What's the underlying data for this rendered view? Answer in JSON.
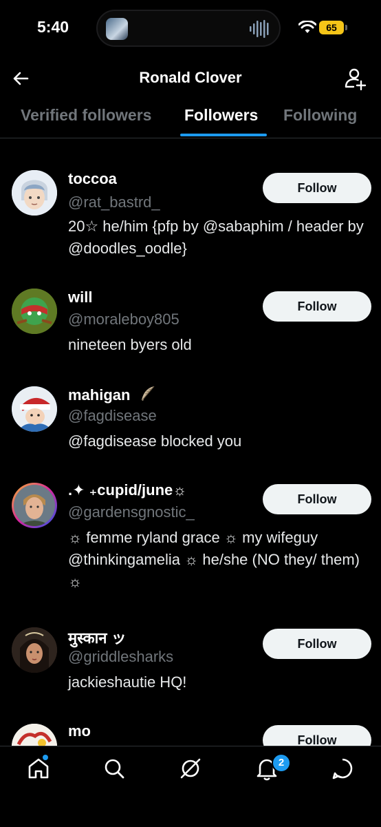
{
  "status_bar": {
    "time": "5:40",
    "battery": "65"
  },
  "header": {
    "title": "Ronald Clover"
  },
  "tabs": [
    {
      "label": "Verified followers"
    },
    {
      "label": "Followers"
    },
    {
      "label": "Following"
    }
  ],
  "users": [
    {
      "name": "toccoa",
      "handle": "@rat_bastrd_",
      "bio": "20☆ he/him {pfp by @sabaphim / header by @doodles_oodle}",
      "follow_label": "Follow"
    },
    {
      "name": "will",
      "handle": "@moraleboy805",
      "bio": "nineteen byers old",
      "follow_label": "Follow"
    },
    {
      "name": "mahigan",
      "handle": "@fagdisease",
      "bio": "@fagdisease blocked you"
    },
    {
      "name": ".✦ ₊cupid/june☼",
      "handle": "@gardensgnostic_",
      "bio": "☼ femme ryland grace ☼ my wifeguy @thinkingamelia ☼ he/she (NO they/ them) ☼",
      "follow_label": "Follow"
    },
    {
      "name": "मुस्कान ッ",
      "handle": "@griddlesharks",
      "bio": "jackieshautie HQ!",
      "follow_label": "Follow"
    },
    {
      "name": "mo",
      "handle": "",
      "bio": "",
      "follow_label": "Follow"
    }
  ],
  "tabbar": {
    "notification_count": "2"
  },
  "colors": {
    "accent": "#1d9bf0",
    "background": "#000000",
    "secondary_text": "#71767b"
  }
}
